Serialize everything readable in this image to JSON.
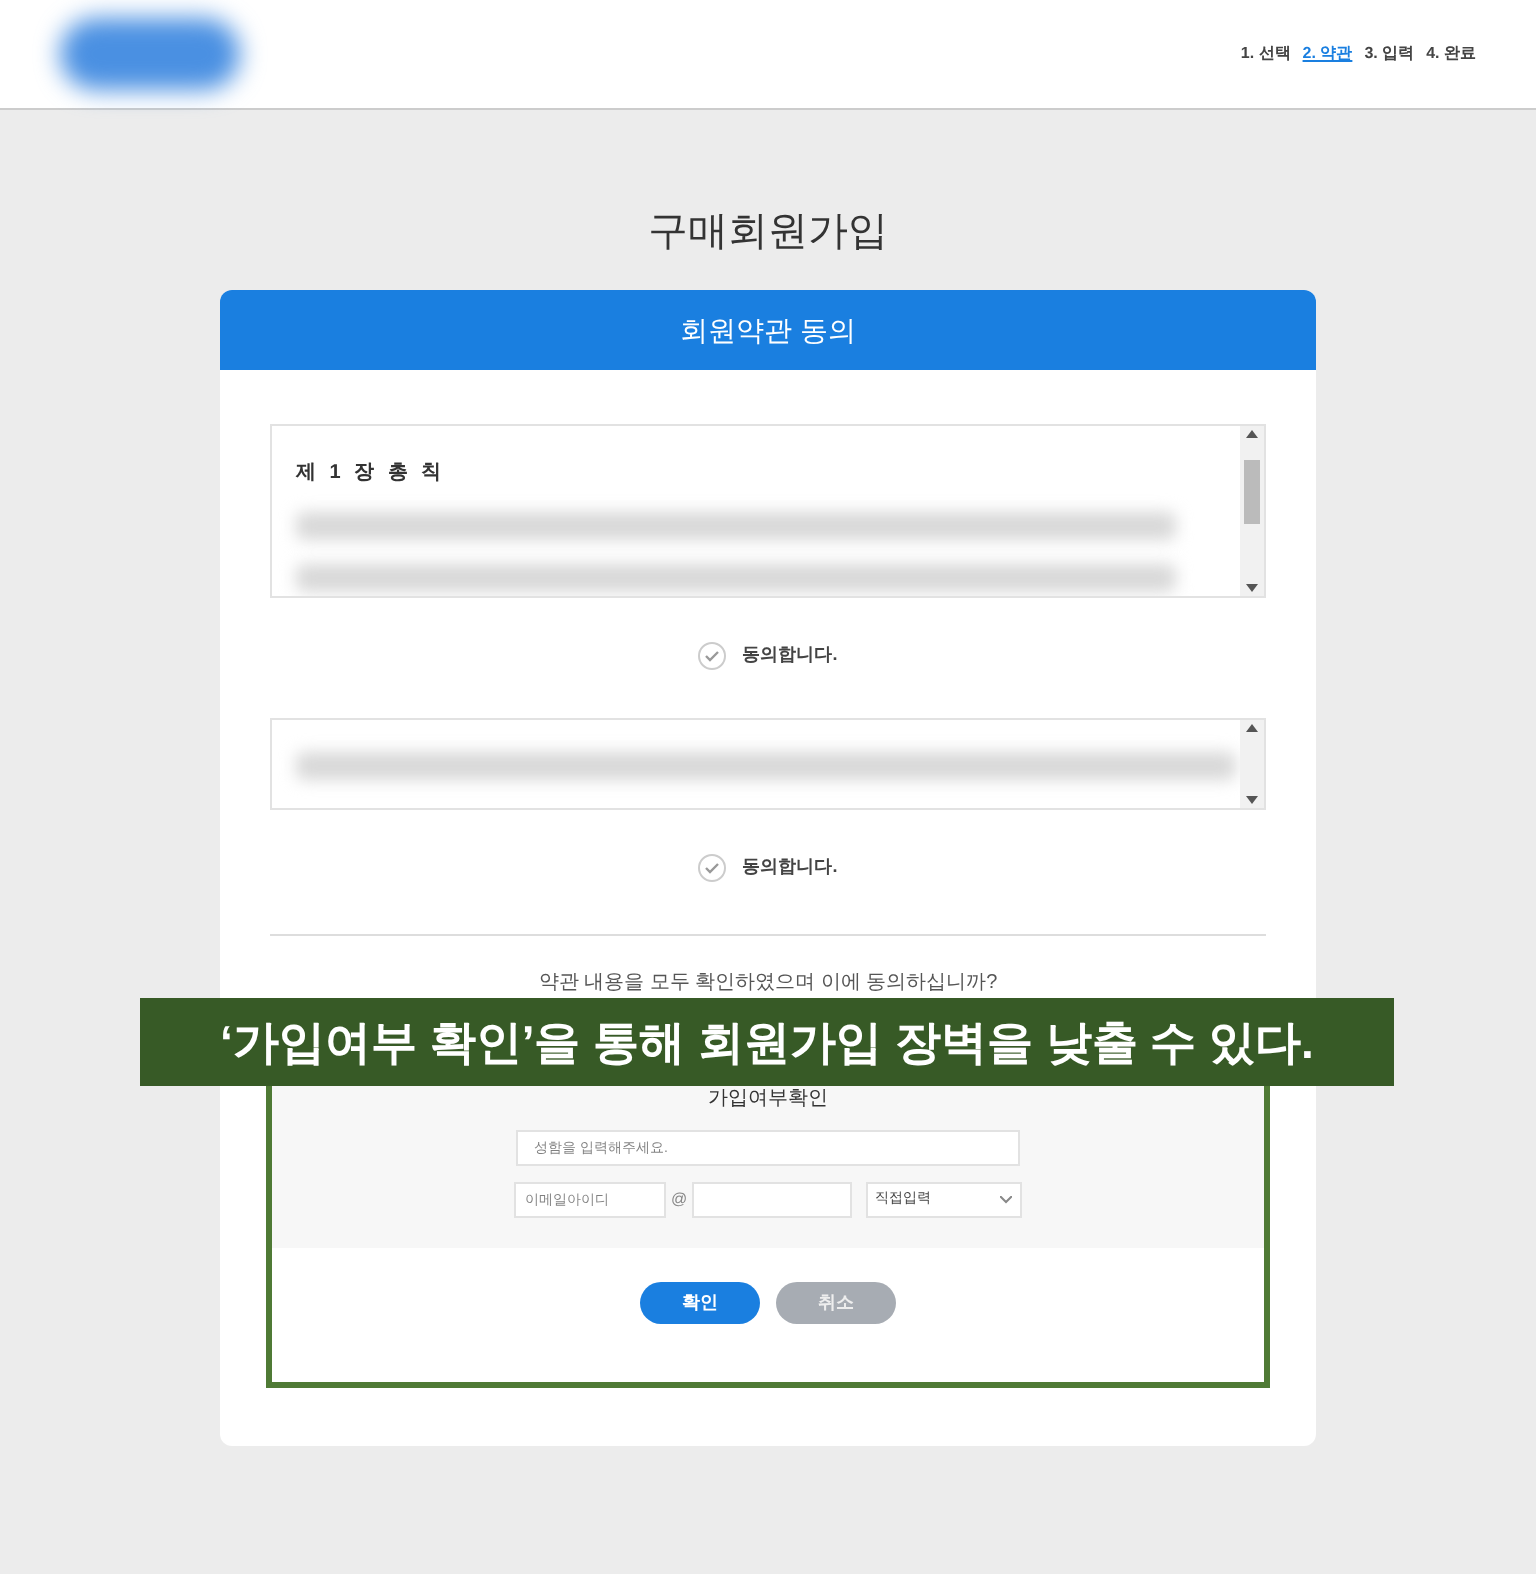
{
  "header": {
    "steps": [
      {
        "label": "1. 선택",
        "selected": false
      },
      {
        "label": "2. 약관",
        "selected": true
      },
      {
        "label": "3. 입력",
        "selected": false
      },
      {
        "label": "4. 완료",
        "selected": false
      }
    ]
  },
  "page_title": "구매회원가입",
  "card": {
    "title": "회원약관 동의",
    "terms": [
      {
        "heading": "제 1 장 총 칙",
        "agree_label": "동의합니다.",
        "checked": false
      },
      {
        "agree_label": "동의합니다.",
        "checked": false
      }
    ],
    "question": "약관 내용을 모두 확인하였으며 이에 동의하십니까?",
    "check_section": {
      "title": "가입여부확인",
      "name_placeholder": "성함을 입력해주세요.",
      "email_id_placeholder": "이메일아이디",
      "at": "@",
      "domain_select": "직접입력"
    },
    "buttons": [
      {
        "label": "확인",
        "kind": "primary"
      },
      {
        "label": "취소",
        "kind": "secondary"
      }
    ]
  },
  "caption": "‘가입여부 확인’을 통해 회원가입 장벽을 낮출 수 있다."
}
